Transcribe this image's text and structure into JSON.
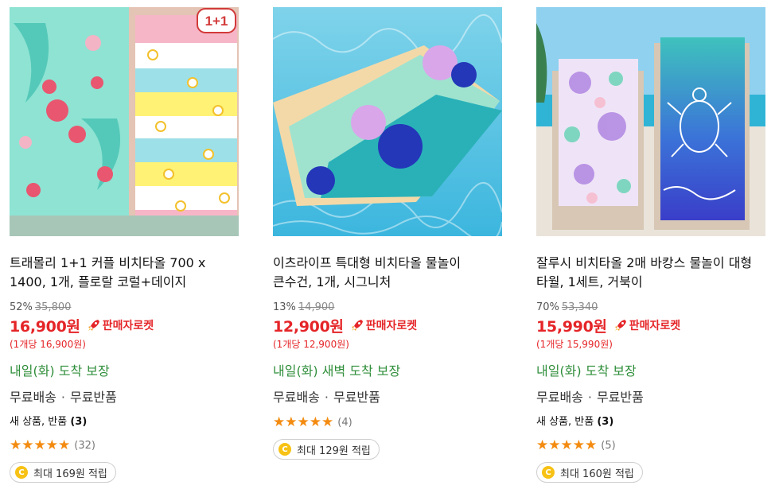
{
  "products": [
    {
      "title": "트래몰리 1+1 커플 비치타올 700 x 1400, 1개, 플로랄 코럴+데이지",
      "discount_rate": "52%",
      "original_price": "35,800",
      "price": "16,900원",
      "delivery_badge": "판매자로켓",
      "unit_price": "(1개당 16,900원)",
      "arrival": "내일(화) 도착 보장",
      "shipping_free": "무료배송",
      "return_free": "무료반품",
      "new_item_label": "새 상품, 반품",
      "new_item_count": "(3)",
      "rating": 5,
      "review_count": "(32)",
      "cashback": "최대 169원 적립",
      "badge": "1+1"
    },
    {
      "title": "이츠라이프 특대형 비치타올 물놀이 큰수건, 1개, 시그니처",
      "discount_rate": "13%",
      "original_price": "14,900",
      "price": "12,900원",
      "delivery_badge": "판매자로켓",
      "unit_price": "(1개당 12,900원)",
      "arrival": "내일(화) 새벽 도착 보장",
      "shipping_free": "무료배송",
      "return_free": "무료반품",
      "rating": 5,
      "review_count": "(4)",
      "cashback": "최대 129원 적립"
    },
    {
      "title": "잘루시 비치타올 2매 바캉스 물놀이 대형 타월, 1세트, 거북이",
      "discount_rate": "70%",
      "original_price": "53,340",
      "price": "15,990원",
      "delivery_badge": "판매자로켓",
      "unit_price": "(1개당 15,990원)",
      "arrival": "내일(화) 도착 보장",
      "shipping_free": "무료배송",
      "return_free": "무료반품",
      "new_item_label": "새 상품, 반품",
      "new_item_count": "(3)",
      "rating": 5,
      "review_count": "(5)",
      "cashback": "최대 160원 적립"
    }
  ],
  "icons": {
    "rocket": "rocket-icon",
    "coin": "coin-icon",
    "star": "star-icon",
    "coin_letter": "C"
  },
  "colors": {
    "price_red": "#e52528",
    "arrival_green": "#2f8e3a",
    "star_orange": "#f38b10",
    "coin_yellow": "#f7c215"
  }
}
